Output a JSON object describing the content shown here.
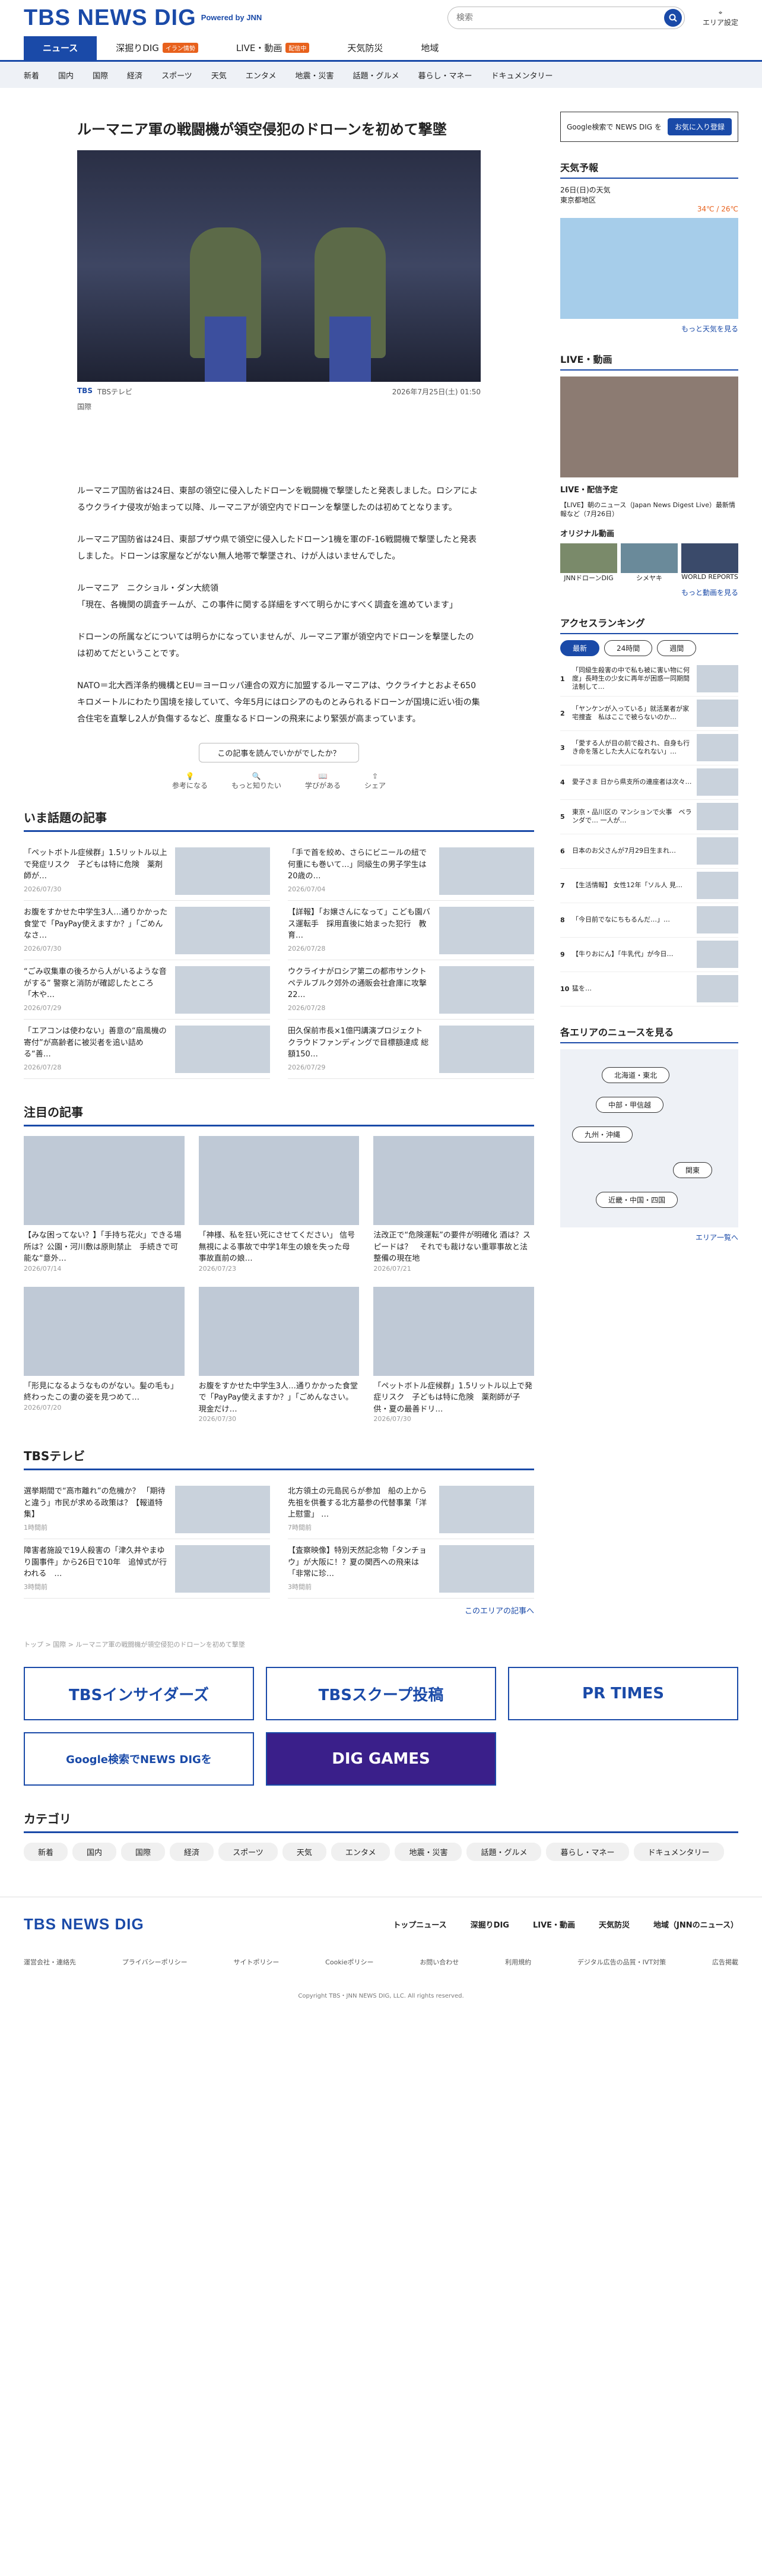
{
  "header": {
    "logo": "TBS NEWS DIG",
    "powered": "Powered by JNN",
    "search_placeholder": "検索",
    "area": "エリア設定"
  },
  "tabs": [
    {
      "label": "ニュース"
    },
    {
      "label": "深掘りDIG",
      "badge": "イラン情勢"
    },
    {
      "label": "LIVE・動画",
      "badge": "配信中"
    },
    {
      "label": "天気防災"
    },
    {
      "label": "地域"
    }
  ],
  "subnav": [
    "新着",
    "国内",
    "国際",
    "経済",
    "スポーツ",
    "天気",
    "エンタメ",
    "地震・災害",
    "話題・グルメ",
    "暮らし・マネー",
    "ドキュメンタリー"
  ],
  "article": {
    "title": "ルーマニア軍の戦闘機が領空侵犯のドローンを初めて撃墜",
    "source": "TBS",
    "source_name": "TBSテレビ",
    "category": "国際",
    "date": "2026年7月25日(土) 01:50",
    "paragraphs": [
      "ルーマニア国防省は24日、東部の領空に侵入したドローンを戦闘機で撃墜したと発表しました。ロシアによるウクライナ侵攻が始まって以降、ルーマニアが領空内でドローンを撃墜したのは初めてとなります。",
      "ルーマニア国防省は24日、東部ブザウ県で領空に侵入したドローン1機を軍のF-16戦闘機で撃墜したと発表しました。ドローンは家屋などがない無人地帯で撃墜され、けが人はいませんでした。",
      "ルーマニア　ニクショル・ダン大統領\n「現在、各機関の調査チームが、この事件に関する詳細をすべて明らかにすべく調査を進めています」",
      "ドローンの所属などについては明らかになっていませんが、ルーマニア軍が領空内でドローンを撃墜したのは初めてだということです。",
      "NATO＝北大西洋条約機構とEU＝ヨーロッパ連合の双方に加盟するルーマニアは、ウクライナとおよそ650キロメートルにわたり国境を接していて、今年5月にはロシアのものとみられるドローンが国境に近い街の集合住宅を直撃し2人が負傷するなど、度重なるドローンの飛来により緊張が高まっています。"
    ],
    "ask": "この記事を読んでいかがでしたか？",
    "reactions": [
      "参考になる",
      "もっと知りたい",
      "学びがある",
      "シェア"
    ]
  },
  "topics": {
    "title": "いま話題の記事",
    "items": [
      {
        "t": "「ペットボトル症候群」1.5リットル以上で発症リスク　子どもは特に危険　薬剤師が…",
        "m": "2026/07/30"
      },
      {
        "t": "「手で首を絞め、さらにビニールの紐で何重にも巻いて…」同級生の男子学生は20歳の…",
        "m": "2026/07/04"
      },
      {
        "t": "お腹をすかせた中学生3人…通りかかった食堂で「PayPay使えますか？」「ごめんなさ…",
        "m": "2026/07/30"
      },
      {
        "t": "【詳報】「お嬢さんになって」こども園バス運転手　採用直後に始まった犯行　教育…",
        "m": "2026/07/28"
      },
      {
        "t": "“ごみ収集車の後ろから人がいるような音がする” 警察と消防が確認したところ「木や…",
        "m": "2026/07/29"
      },
      {
        "t": "ウクライナがロシア第二の都市サンクトペテルブルク郊外の通販会社倉庫に攻撃　22…",
        "m": "2026/07/28"
      },
      {
        "t": "「エアコンは使わない」善意の“扇風機の寄付”が高齢者に被災者を追い詰める“善…",
        "m": "2026/07/28"
      },
      {
        "t": "田久保前市長×1億円講演プロジェクト クラウドファンディングで目標額達成 総額150…",
        "m": "2026/07/29"
      }
    ]
  },
  "featured": {
    "title": "注目の記事",
    "items": [
      {
        "t": "【みな困ってない？】「手持ち花火」できる場所は？公園・河川敷は原則禁止　手続きで可能な“意外…",
        "m": "2026/07/14"
      },
      {
        "t": "「神様、私を狂い死にさせてください」 信号無視による事故で中学1年生の娘を失った母　事故直前の娘…",
        "m": "2026/07/23"
      },
      {
        "t": "法改正で“危険運転”の要件が明確化 酒は？スピードは？　それでも裁けない重罪事故と法整備の現在地",
        "m": "2026/07/21"
      },
      {
        "t": "「形見になるようなものがない。髪の毛も」 終わったこの妻の姿を見つめて…",
        "m": "2026/07/20"
      },
      {
        "t": "お腹をすかせた中学生3人…通りかかった食堂で「PayPay使えますか？」「ごめんなさい。現金だけ…",
        "m": "2026/07/30"
      },
      {
        "t": "「ペットボトル症候群」1.5リットル以上で発症リスク　子どもは特に危険　薬剤師が子供・夏の最善ドリ…",
        "m": "2026/07/30"
      }
    ]
  },
  "tbs_local": {
    "title": "TBSテレビ",
    "link": "このエリアの記事へ",
    "items": [
      {
        "t": "選挙期間で“高市離れ”の危機か？ 「期待と違う」市民が求める政策は？【報道特集】",
        "m": "1時間前"
      },
      {
        "t": "北方領土の元島民らが参加　船の上から先祖を供養する北方墓参の代替事業「洋上慰霊」 …",
        "m": "7時間前"
      },
      {
        "t": "障害者施設で19人殺害の「津久井やまゆり園事件」から26日で10年　追悼式が行われる　…",
        "m": "3時間前"
      },
      {
        "t": "【査察映像】特別天然記念物「タンチョウ」が大阪に！？夏の関西への飛来は「非常に珍…",
        "m": "3時間前"
      }
    ]
  },
  "breadcrumb": "トップ > 国際 > ルーマニア軍の戦闘機が領空侵犯のドローンを初めて撃墜",
  "banners": [
    "TBSインサイダーズ",
    "TBSスクープ投稿",
    "PR TIMES",
    "Google検索でNEWS DIGを",
    "DIG GAMES"
  ],
  "categories": {
    "title": "カテゴリ",
    "items": [
      "新着",
      "国内",
      "国際",
      "経済",
      "スポーツ",
      "天気",
      "エンタメ",
      "地震・災害",
      "話題・グルメ",
      "暮らし・マネー",
      "ドキュメンタリー"
    ]
  },
  "sidebar": {
    "google": "Google検索で NEWS DIG を",
    "google_btn": "お気に入り登録",
    "weather_title": "天気予報",
    "weather_date": "26日(日)の天気",
    "weather_region": "東京都地区",
    "temp": "34℃ / 26℃",
    "weather_more": "もっと天気を見る",
    "live_title": "LIVE・動画",
    "live_sub": "LIVE・配信予定",
    "live_item": "【LIVE】朝のニュース（Japan News Digest Live）最新情報など（7月26日）",
    "video_title": "オリジナル動画",
    "videos": [
      "JNNドローンDIG",
      "シメヤキ",
      "WORLD REPORTS"
    ],
    "video_more": "もっと動画を見る",
    "ranking_title": "アクセスランキング",
    "ranking_tabs": [
      "最新",
      "24時間",
      "週間"
    ],
    "ranking": [
      "「同級生殺害の中で私も被に害い物に何度」長時生の少女に再年が困惑一同期間法制して…",
      "「ヤンケンが入っている」就活業者が家宅捜査　私はここで被らないのか…",
      "「愛する人が目の前で殺され、自身も行き命を落とした大人になれない」…",
      "愛子さま 日から県支所の連座者は次々…",
      "東京・品川区の マンションで火事　ベランダで… 一人が…",
      "日本のお父さんが7月29日生まれ…",
      "【生活情報】 女性12年「ソル人 見…",
      "「今日前でなにちもるんだ…」…",
      "【牛りおにん】「牛乳代」が今日…",
      "猛を…"
    ],
    "area_title": "各エリアのニュースを見る",
    "areas": [
      "北海道・東北",
      "中部・甲信越",
      "九州・沖縄",
      "関東",
      "近畿・中国・四国"
    ],
    "area_more": "エリア一覧へ"
  },
  "footer": {
    "logo": "TBS NEWS DIG",
    "links": [
      "トップニュース",
      "深掘りDIG",
      "LIVE・動画",
      "天気防災",
      "地域（JNNのニュース）"
    ],
    "sublinks": [
      "運営会社・連絡先",
      "プライバシーポリシー",
      "サイトポリシー",
      "Cookieポリシー",
      "お問い合わせ",
      "利用規約",
      "デジタル広告の品質・IVT対策",
      "広告掲載"
    ],
    "copy": "Copyright TBS・JNN NEWS DIG, LLC. All rights reserved."
  }
}
